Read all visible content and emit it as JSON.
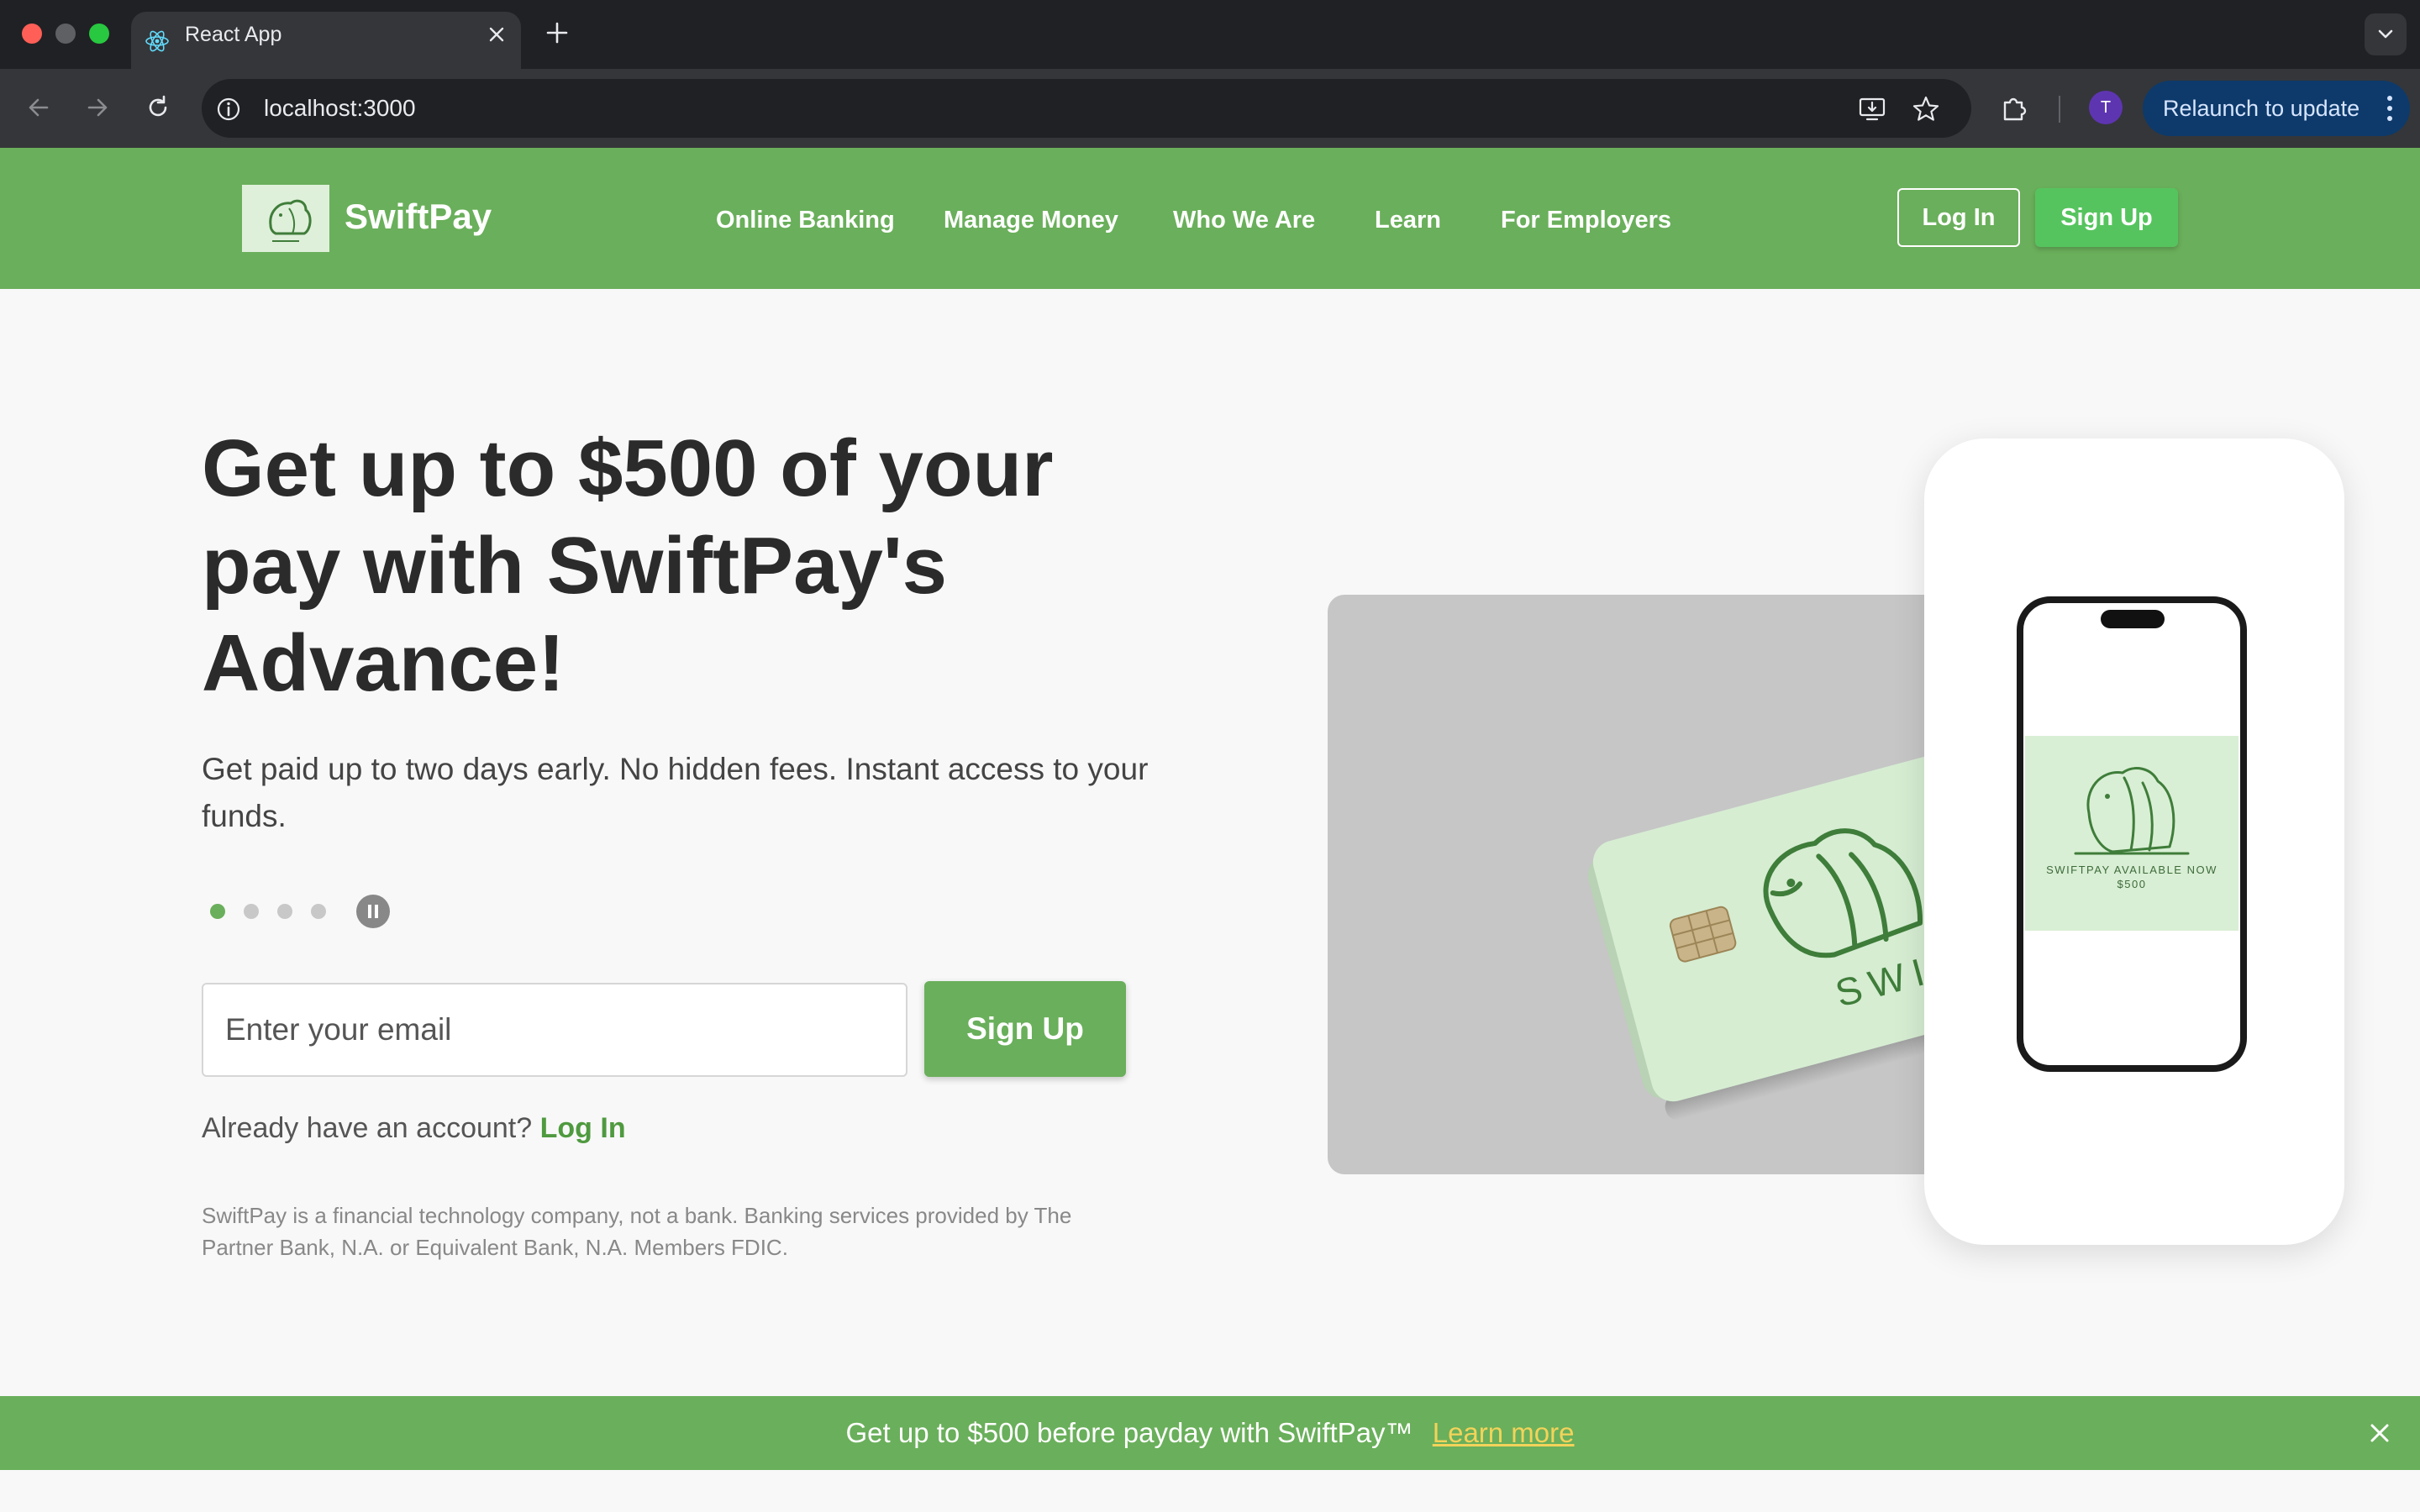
{
  "browser": {
    "tab_title": "React App",
    "url": "localhost:3000",
    "profile_initial": "T",
    "relaunch_label": "Relaunch to update"
  },
  "header": {
    "brand": "SwiftPay",
    "nav": [
      "Online Banking",
      "Manage Money",
      "Who We Are",
      "Learn",
      "For Employers"
    ],
    "login_label": "Log In",
    "signup_label": "Sign Up"
  },
  "hero": {
    "title": "Get up to $500 of your pay with SwiftPay's Advance!",
    "subtitle": "Get paid up to two days early. No hidden fees. Instant access to your funds.",
    "carousel": {
      "slide_count": 4,
      "active_index": 0
    },
    "email_placeholder": "Enter your email",
    "signup_label": "Sign Up",
    "account_prompt": "Already have an account?",
    "account_login": "Log In",
    "disclaimer": "SwiftPay is a financial technology company, not a bank. Banking services provided by The Partner Bank, N.A. or Equivalent Bank, N.A. Members FDIC."
  },
  "visuals": {
    "card_brand": "SWIFTPA",
    "phone_caption_line1": "SWIFTPAY AVAILABLE NOW",
    "phone_caption_line2": "$500"
  },
  "banner": {
    "text": "Get up to $500 before payday with SwiftPay™",
    "link": "Learn more"
  },
  "colors": {
    "brand_green": "#6aaf5b",
    "signup_green": "#56c45e",
    "banner_link": "#f2d35a"
  }
}
